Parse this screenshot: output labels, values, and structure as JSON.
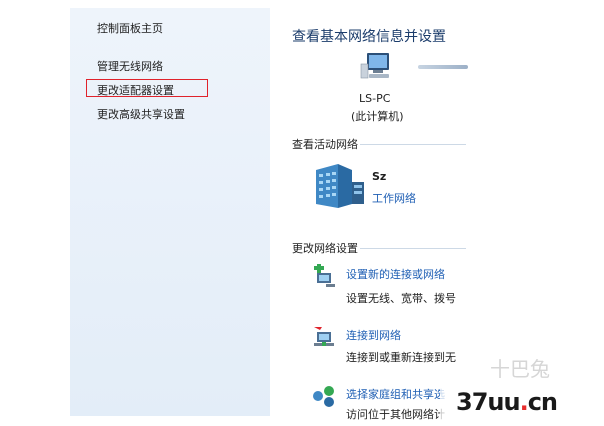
{
  "sidebar": {
    "items": [
      {
        "label": "控制面板主页"
      },
      {
        "label": "管理无线网络"
      },
      {
        "label": "更改适配器设置"
      },
      {
        "label": "更改高级共享设置"
      }
    ]
  },
  "main": {
    "title": "查看基本网络信息并设置",
    "computer": {
      "name": "LS-PC",
      "sub": "(此计算机)"
    },
    "active_network_heading": "查看活动网络",
    "network": {
      "name": "Sz",
      "type": "工作网络"
    },
    "change_settings_heading": "更改网络设置",
    "tasks": [
      {
        "link": "设置新的连接或网络",
        "desc": "设置无线、宽带、拨号"
      },
      {
        "link": "连接到网络",
        "desc": "连接到或重新连接到无"
      },
      {
        "link": "选择家庭组和共享选",
        "desc": "访问位于其他网络计"
      }
    ]
  },
  "watermark": {
    "brand_a": "37uu",
    "brand_dot": ".",
    "brand_b": "cn",
    "faint": "十巴兔"
  },
  "colors": {
    "link": "#1f5fb4",
    "highlight": "#e0222b",
    "sidebar_bg": "#e8f0f9"
  }
}
